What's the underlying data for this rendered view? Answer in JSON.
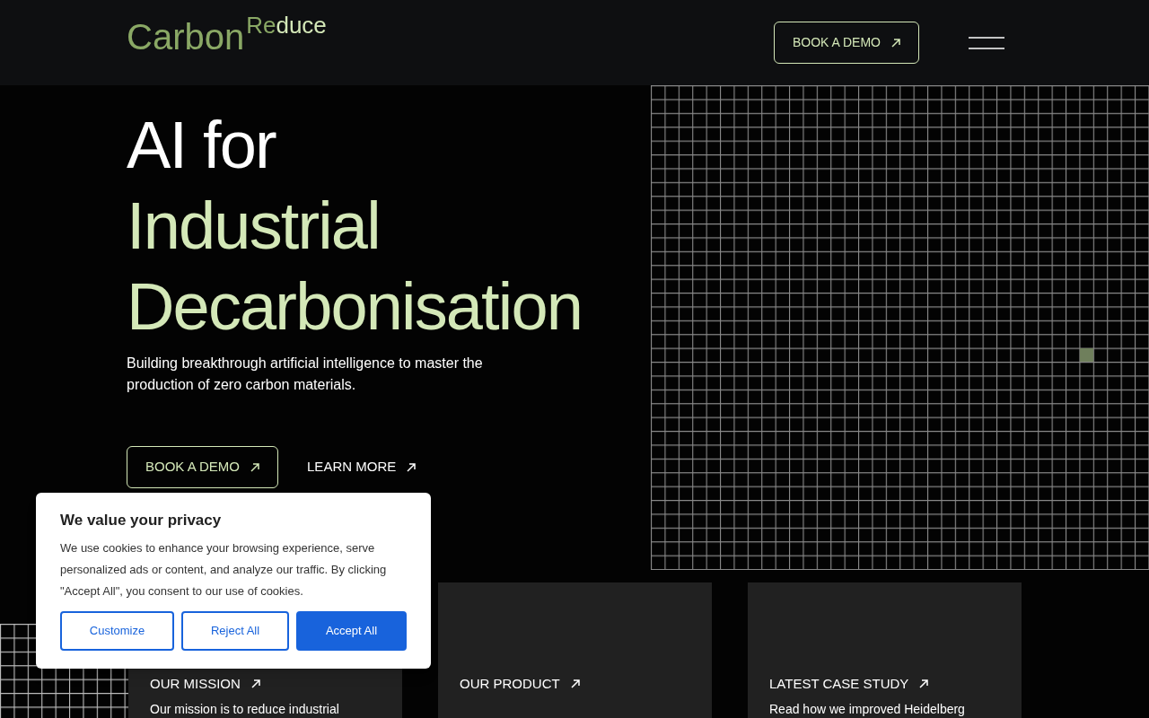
{
  "header": {
    "logo": {
      "main": "Carbon",
      "super_accent": "Re",
      "super_rest": "duce"
    },
    "cta": "BOOK A DEMO"
  },
  "hero": {
    "title_line": "AI for",
    "title_accent": [
      "Industrial",
      "Decarbonisation"
    ],
    "subtitle": "Building breakthrough artificial intelligence to master the production of zero carbon materials.",
    "buttons": [
      {
        "kind": "outline",
        "label": "BOOK A DEMO"
      },
      {
        "kind": "plain",
        "label": "LEARN MORE"
      }
    ]
  },
  "cards": [
    {
      "title": "OUR MISSION",
      "text": "Our mission is to reduce industrial"
    },
    {
      "title": "OUR PRODUCT"
    },
    {
      "title": "LATEST CASE STUDY",
      "text": "Read how we improved Heidelberg"
    }
  ],
  "cookie_banner": {
    "title": "We value your privacy",
    "text": "We use cookies to enhance your browsing experience, serve personalized ads or content, and analyze our traffic. By clicking \"Accept All\", you consent to our use of cookies.",
    "buttons": [
      {
        "kind": "outline",
        "label": "Customize"
      },
      {
        "kind": "outline",
        "label": "Reject All"
      },
      {
        "kind": "primary",
        "label": "Accept All"
      }
    ]
  }
}
